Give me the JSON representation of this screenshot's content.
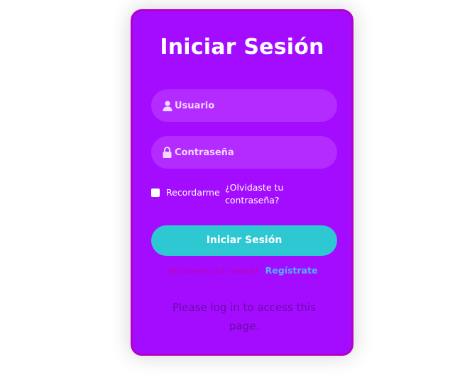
{
  "login": {
    "title": "Iniciar Sesión",
    "username_placeholder": "Usuario",
    "password_placeholder": "Contraseña",
    "remember_label": "Recordarme",
    "forgot_link": "¿Olvidaste tu contraseña?",
    "submit_label": "Iniciar Sesión",
    "register_prompt": "¿No tienes una cuenta?",
    "register_link": "Regístrate",
    "notice": "Please log in to access this page."
  },
  "icons": {
    "username": "user-icon",
    "password": "lock-icon"
  },
  "colors": {
    "card_background": "#a40cff",
    "card_border": "#b300c9",
    "field_background": "#b32bff",
    "button_background": "#2ec8d2",
    "register_link": "#4fb4ff",
    "notice_text": "#6a0aa6"
  }
}
